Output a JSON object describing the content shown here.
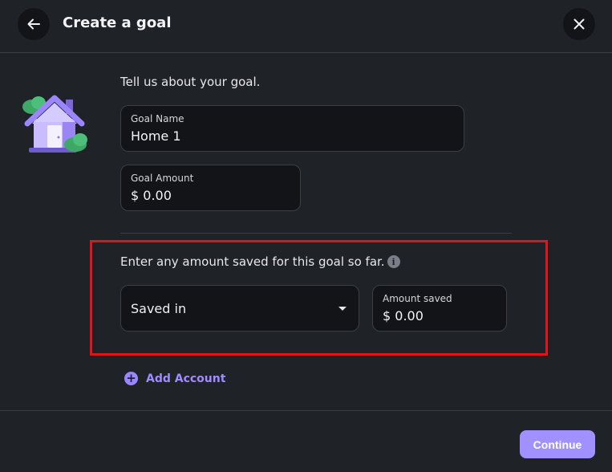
{
  "header": {
    "title": "Create a goal",
    "back_icon": "arrow-left-icon",
    "close_icon": "close-icon"
  },
  "illustration": {
    "icon": "house-icon"
  },
  "form": {
    "intro": "Tell us about your goal.",
    "goal_name": {
      "label": "Goal Name",
      "value": "Home 1"
    },
    "goal_amount": {
      "label": "Goal Amount",
      "value": "$ 0.00"
    },
    "saved_prompt": "Enter any amount saved for this goal so far.",
    "saved_in": {
      "selected": "Saved in"
    },
    "amount_saved": {
      "label": "Amount saved",
      "value": "$ 0.00"
    },
    "add_account": "Add Account"
  },
  "footer": {
    "continue_label": "Continue"
  },
  "colors": {
    "background": "#1f2227",
    "field_bg": "#131417",
    "accent": "#a190ff",
    "highlight": "#e0141b"
  }
}
